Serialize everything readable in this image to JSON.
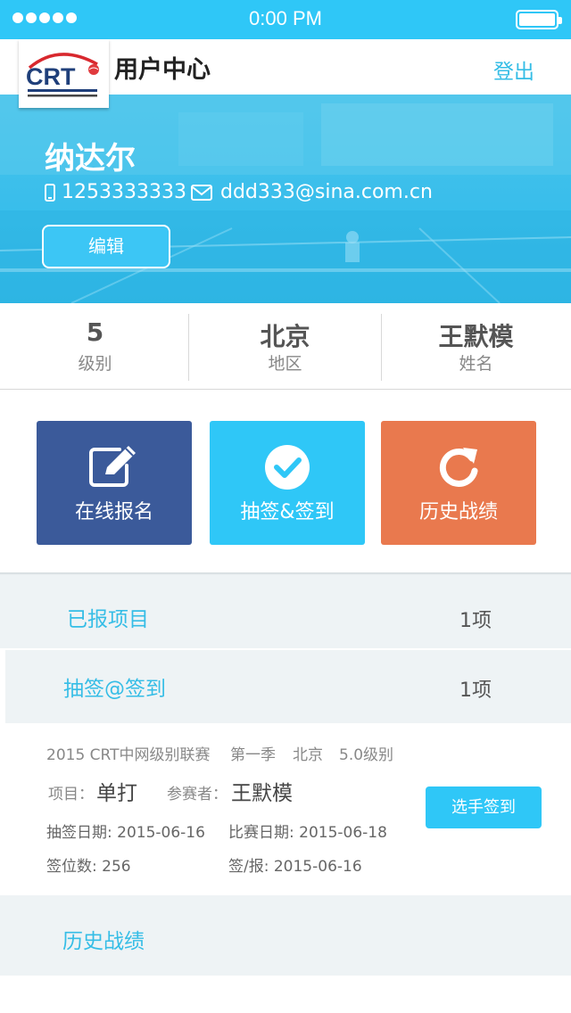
{
  "status_bar": {
    "time": "0:00 PM"
  },
  "header": {
    "title": "用户中心",
    "logout_label": "登出",
    "logo_text": "CRT"
  },
  "profile": {
    "name": "纳达尔",
    "phone": "1253333333",
    "email": "ddd333@sina.com.cn",
    "edit_label": "编辑"
  },
  "stats": [
    {
      "value": "5",
      "label": "级别"
    },
    {
      "value": "北京",
      "label": "地区"
    },
    {
      "value": "王默模",
      "label": "姓名"
    }
  ],
  "actions": [
    {
      "label": "在线报名",
      "icon": "edit-icon",
      "color": "#3b5a9a"
    },
    {
      "label": "抽签&签到",
      "icon": "check-circle-icon",
      "color": "#2fc7f7"
    },
    {
      "label": "历史战绩",
      "icon": "refresh-icon",
      "color": "#e9794e"
    }
  ],
  "sections": {
    "registered": {
      "label": "已报项目",
      "count": "1项"
    },
    "draw": {
      "label": "抽签@签到",
      "count": "1项"
    },
    "history": {
      "label": "历史战绩"
    }
  },
  "event": {
    "title": "2015 CRT中网级别联赛",
    "season": "第一季",
    "city": "北京",
    "level": "5.0级别",
    "item_label": "项目：",
    "item_value": "单打",
    "player_label": "参赛者：",
    "player_value": "王默模",
    "draw_date": "抽签日期: 2015-06-16",
    "match_date": "比赛日期: 2015-06-18",
    "slots": "签位数: 256",
    "sign_report": "签/报: 2015-06-16",
    "checkin_label": "选手签到"
  },
  "colors": {
    "accent": "#2fc7f7",
    "link": "#35bde6",
    "navy": "#3b5a9a",
    "orange": "#e9794e"
  }
}
